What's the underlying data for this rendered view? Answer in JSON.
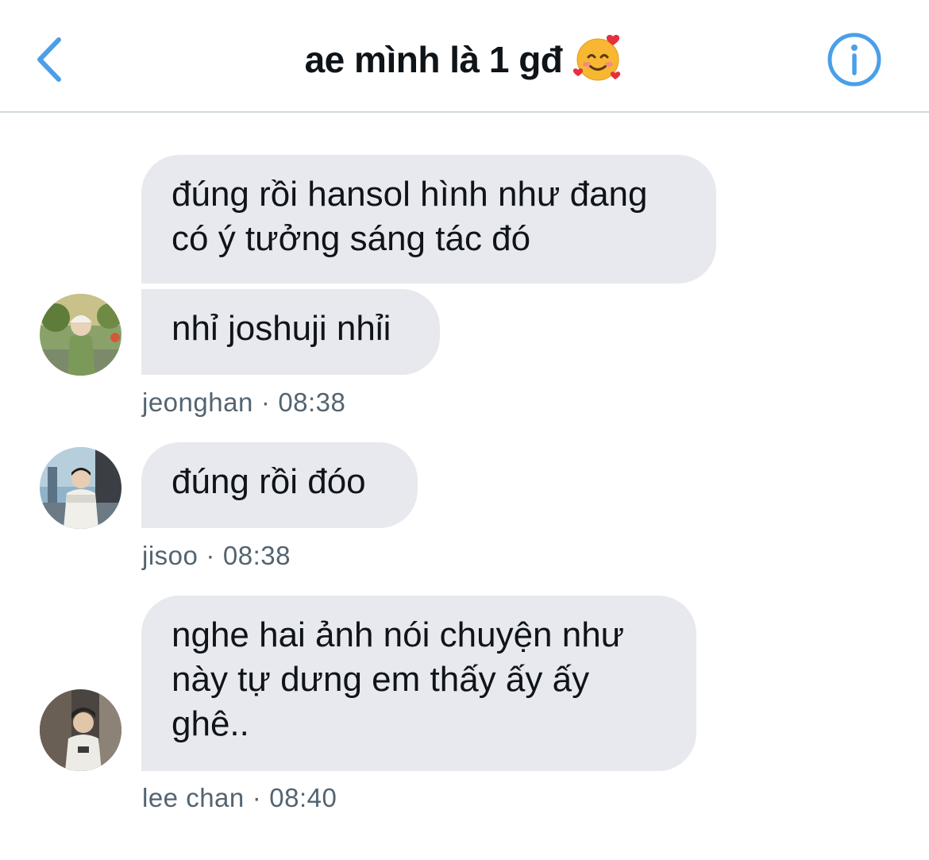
{
  "header": {
    "title": "ae mình là 1 gđ",
    "title_emoji": "smiling-face-with-hearts-icon"
  },
  "colors": {
    "accent": "#4a9fe8",
    "bubble_bg": "#e7e9ef",
    "meta_text": "#536471",
    "divider": "#cfd9de"
  },
  "messages": [
    {
      "sender": "jeonghan",
      "time": "08:38",
      "lines": [
        [
          "đúng rồi hansol hình như đang",
          "có ý tưởng sáng tác đó"
        ],
        [
          "nhỉ joshuji nhỉi"
        ]
      ]
    },
    {
      "sender": "jisoo",
      "time": "08:38",
      "lines": [
        [
          "đúng rồi đóo"
        ]
      ]
    },
    {
      "sender": "lee chan",
      "time": "08:40",
      "lines": [
        [
          "nghe hai ảnh nói chuyện như",
          "này tự dưng em thấy ấy ấy",
          "ghê.."
        ]
      ]
    }
  ],
  "separator": "·"
}
